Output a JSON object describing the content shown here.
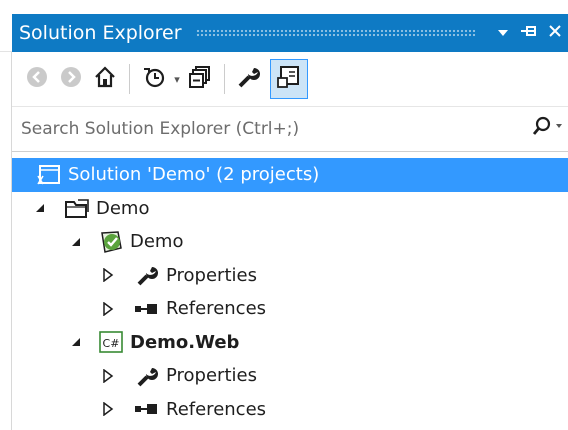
{
  "panel": {
    "title": "Solution Explorer",
    "dropdown_glyph": "▾",
    "pin_glyph": "⊣",
    "close_glyph": "✕"
  },
  "toolbar": {
    "icons": [
      "back-icon",
      "forward-icon",
      "home-icon",
      "history-icon",
      "collapse-all-icon",
      "properties-icon",
      "preview-icon"
    ],
    "caret": "▾"
  },
  "search": {
    "placeholder": "Search Solution Explorer (Ctrl+;)",
    "caret": "▾"
  },
  "tree": {
    "solution": "Solution 'Demo' (2 projects)",
    "folder": "Demo",
    "project1": "Demo",
    "project1_properties": "Properties",
    "project1_references": "References",
    "project2": "Demo.Web",
    "project2_properties": "Properties",
    "project2_references": "References",
    "csharp_badge": "C#"
  },
  "colors": {
    "accent": "#0e7ac4",
    "selection": "#3399ff"
  }
}
